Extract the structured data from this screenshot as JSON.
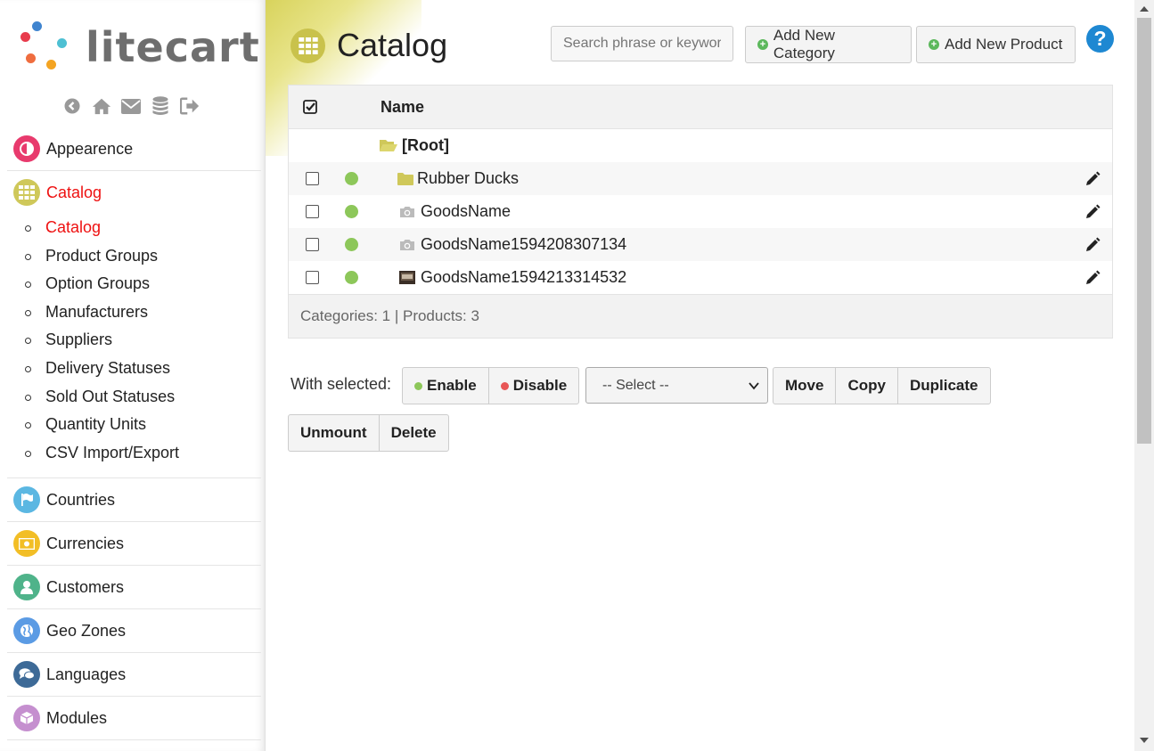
{
  "logo": {
    "text": "litecart",
    "dot_colors": [
      "#e83b4c",
      "#3f84cf",
      "#4ec0d3",
      "#f4a422",
      "#ef6d3f"
    ]
  },
  "shortcuts": [
    "back-icon",
    "home-icon",
    "mail-icon",
    "database-icon",
    "sign-out-icon"
  ],
  "sidebar": {
    "apps": [
      {
        "label": "Appearence",
        "icon": "appearance-icon",
        "color": "#e83a6d"
      },
      {
        "label": "Catalog",
        "icon": "grid-icon",
        "color": "#cfc85a",
        "active": true,
        "docs": [
          "Catalog",
          "Product Groups",
          "Option Groups",
          "Manufacturers",
          "Suppliers",
          "Delivery Statuses",
          "Sold Out Statuses",
          "Quantity Units",
          "CSV Import/Export"
        ]
      },
      {
        "label": "Countries",
        "icon": "flag-icon",
        "color": "#5bb7e2"
      },
      {
        "label": "Currencies",
        "icon": "money-icon",
        "color": "#f2be26"
      },
      {
        "label": "Customers",
        "icon": "user-icon",
        "color": "#4fb38a"
      },
      {
        "label": "Geo Zones",
        "icon": "globe-icon",
        "color": "#5b9be4"
      },
      {
        "label": "Languages",
        "icon": "comments-icon",
        "color": "#3d6a97"
      },
      {
        "label": "Modules",
        "icon": "cube-icon",
        "color": "#c58fcf"
      }
    ]
  },
  "header": {
    "title": "Catalog",
    "search_placeholder": "Search phrase or keyword",
    "add_category": "Add New Category",
    "add_product": "Add New Product",
    "help": "?"
  },
  "table": {
    "header_name": "Name",
    "root": "[Root]",
    "rows": [
      {
        "name": "Rubber Ducks",
        "type": "folder-icon"
      },
      {
        "name": "GoodsName",
        "type": "camera-icon"
      },
      {
        "name": "GoodsName1594208307134",
        "type": "camera-icon"
      },
      {
        "name": "GoodsName1594213314532",
        "type": "thumbnail-icon"
      }
    ],
    "footer": "Categories: 1 | Products: 3"
  },
  "actions": {
    "label": "With selected:",
    "enable": "Enable",
    "disable": "Disable",
    "select": "-- Select --",
    "move": "Move",
    "copy": "Copy",
    "duplicate": "Duplicate",
    "unmount": "Unmount",
    "delete": "Delete"
  }
}
